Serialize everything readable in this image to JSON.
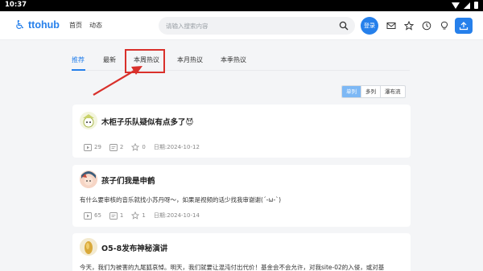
{
  "status_bar": {
    "time": "10:37"
  },
  "header": {
    "logo_text": "ttohub",
    "nav": [
      "首页",
      "动态"
    ],
    "search_placeholder": "请输入搜索内容",
    "login_label": "登录",
    "icons": [
      "mail-icon",
      "star-icon",
      "history-icon",
      "bulb-icon",
      "upload-icon"
    ]
  },
  "tabs": [
    "推荐",
    "最新",
    "本周热议",
    "本月热议",
    "本季热议"
  ],
  "active_tab": "推荐",
  "view_modes": [
    "单列",
    "多列",
    "瀑布流"
  ],
  "active_view": "单列",
  "posts": [
    {
      "title": "木柜子乐队疑似有点多了😈",
      "body": "",
      "views": "29",
      "comments": "2",
      "likes": "0",
      "date": "日期:2024-10-12"
    },
    {
      "title": "孩子们我是申鹤",
      "body": "有什么要审核的音乐就找小苏丹呀～，如果是视频的话少找我审谢谢(´-ω-`)",
      "views": "65",
      "comments": "1",
      "likes": "1",
      "date": "日期:2024-10-14"
    },
    {
      "title": "O5-8发布神秘演讲",
      "body": "今天，我们为被害的九尾狐哀悼。明天，我们就要让混沌付出代价！基金会不会允许，对我site-02的入侵，或对基",
      "views": "",
      "comments": "",
      "likes": "",
      "date": ""
    }
  ],
  "colors": {
    "accent": "#2680eb",
    "highlight": "#d9302b"
  }
}
